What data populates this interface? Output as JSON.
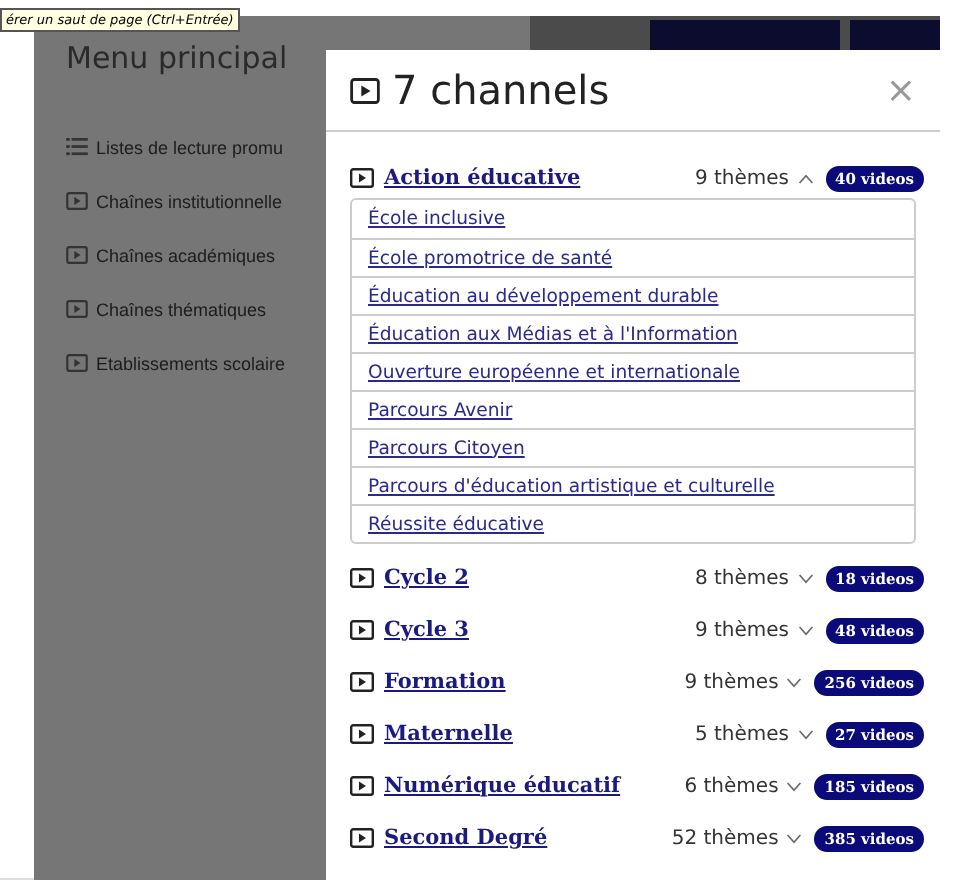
{
  "tooltip": "érer un saut de page (Ctrl+Entrée)",
  "sidebar": {
    "title": "Menu principal",
    "items": [
      {
        "kind": "list",
        "label": "Listes de lecture promu"
      },
      {
        "kind": "channel",
        "label": "Chaînes institutionnelle"
      },
      {
        "kind": "channel",
        "label": "Chaînes académiques"
      },
      {
        "kind": "channel",
        "label": "Chaînes thématiques"
      },
      {
        "kind": "channel",
        "label": "Etablissements scolaire"
      }
    ]
  },
  "modal": {
    "title": "7 channels",
    "close": "×",
    "channels": [
      {
        "name": "Action éducative",
        "themes_count": "9 thèmes",
        "expanded": true,
        "videos": "40 videos",
        "themes": [
          "École inclusive",
          "École promotrice de santé",
          "Éducation au développement durable",
          "Éducation aux Médias et à l'Information",
          "Ouverture européenne et internationale",
          "Parcours Avenir",
          "Parcours Citoyen",
          "Parcours d'éducation artistique et culturelle",
          "Réussite éducative"
        ]
      },
      {
        "name": "Cycle 2",
        "themes_count": "8 thèmes",
        "expanded": false,
        "videos": "18 videos"
      },
      {
        "name": "Cycle 3",
        "themes_count": "9 thèmes",
        "expanded": false,
        "videos": "48 videos"
      },
      {
        "name": "Formation",
        "themes_count": "9 thèmes",
        "expanded": false,
        "videos": "256 videos"
      },
      {
        "name": "Maternelle",
        "themes_count": "5 thèmes",
        "expanded": false,
        "videos": "27 videos"
      },
      {
        "name": "Numérique éducatif",
        "themes_count": "6 thèmes",
        "expanded": false,
        "videos": "185 videos"
      },
      {
        "name": "Second Degré",
        "themes_count": "52 thèmes",
        "expanded": false,
        "videos": "385 videos"
      }
    ]
  }
}
